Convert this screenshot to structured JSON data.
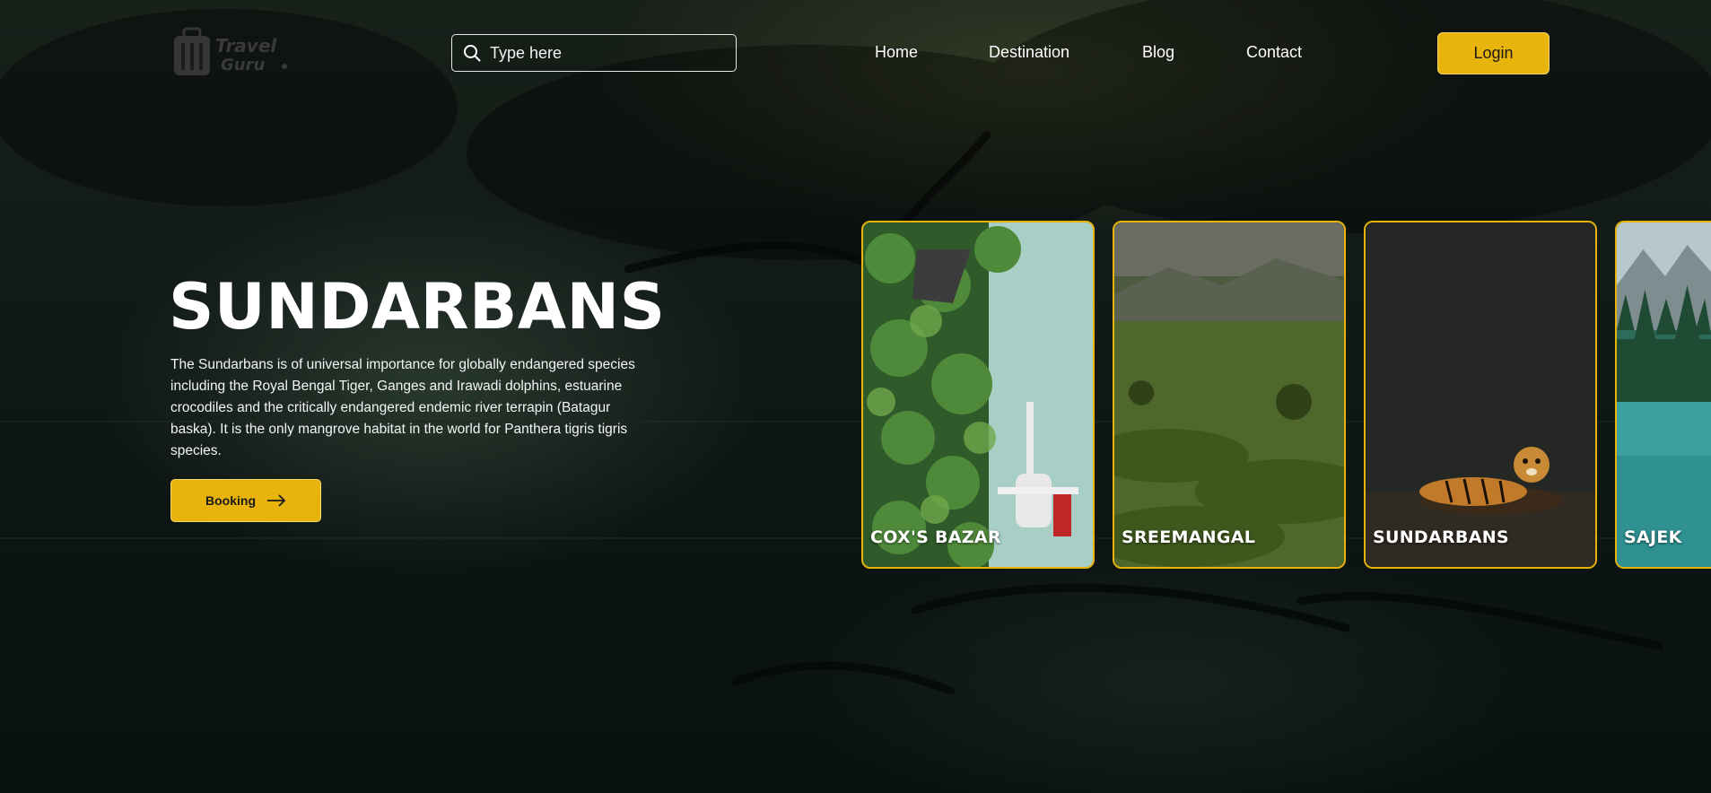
{
  "header": {
    "logo_line1": "Travel",
    "logo_line2": "Guru",
    "search_placeholder": "Type here",
    "nav": [
      "Home",
      "Destination",
      "Blog",
      "Contact"
    ],
    "login_label": "Login"
  },
  "hero": {
    "title": "SUNDARBANS",
    "description": "The Sundarbans is of universal importance for globally endangered species including the Royal Bengal Tiger, Ganges and Irawadi dolphins, estuarine crocodiles and the critically endangered endemic river terrapin (Batagur baska). It is the only mangrove habitat in the world for Panthera tigris tigris species.",
    "booking_label": "Booking"
  },
  "cards": [
    {
      "label": "COX'S BAZAR"
    },
    {
      "label": "SREEMANGAL"
    },
    {
      "label": "SUNDARBANS"
    },
    {
      "label": "SAJEK"
    }
  ],
  "colors": {
    "accent": "#e8b40c",
    "background": "#0e1512"
  },
  "icons": {
    "search": "search-icon",
    "arrow": "arrow-right-icon",
    "logo": "suitcase-icon"
  }
}
